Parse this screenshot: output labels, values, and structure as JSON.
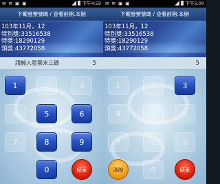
{
  "left": {
    "status_time": "下午4:59",
    "title_button": "下載發票號碼 / 查看前期.本期",
    "info_lines": [
      "103年11月，12",
      "特別獎:33516538",
      "特獎:18290129",
      "頭獎:43772058"
    ],
    "prompt": "請輸入發票末三碼",
    "entered_digit": "5",
    "keys": {
      "k1": "1",
      "k2": "2",
      "k3": "3",
      "k4": "4",
      "k5": "5",
      "k6": "6",
      "k7": "7",
      "k8": "8",
      "k9": "9",
      "k0": "0",
      "exit": "結束"
    }
  },
  "right": {
    "status_time": "下午5:00",
    "title_button": "下載發票號碼 / 查看前期.本期",
    "info_lines": [
      "103年11月，12",
      "特別獎:33516538",
      "特獎:18290129",
      "頭獎:43772058"
    ],
    "entered_digit": "5",
    "keys": {
      "k1": "1",
      "k2": "2",
      "k3": "3",
      "k4": "4",
      "k5": "5",
      "k6": "6",
      "k7": "7",
      "k8": "8",
      "k9": "9",
      "k0": "0",
      "clear": "清除",
      "exit": "結束"
    }
  },
  "colors": {
    "active_key": "#2450c0",
    "exit_key": "#e2230f",
    "clear_key": "#f5a21a",
    "prompt_bar": "#cfe0ea"
  }
}
